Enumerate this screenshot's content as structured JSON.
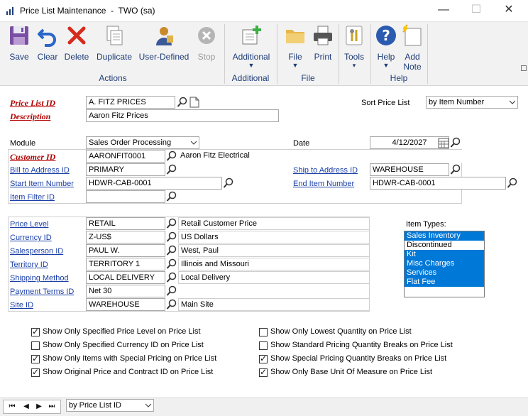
{
  "window": {
    "title": "Price List Maintenance  -  TWO (sa)",
    "minimize_glyph": "—",
    "maximize_glyph": "☐",
    "close_glyph": "✕"
  },
  "ribbon": {
    "buttons": {
      "save": "Save",
      "clear": "Clear",
      "delete": "Delete",
      "duplicate": "Duplicate",
      "user_defined": "User-Defined",
      "stop": "Stop",
      "additional": "Additional",
      "file": "File",
      "print": "Print",
      "tools": "Tools",
      "help": "Help",
      "add_note_1": "Add",
      "add_note_2": "Note"
    },
    "groups": {
      "actions": "Actions",
      "additional": "Additional",
      "file": "File",
      "help": "Help"
    }
  },
  "form": {
    "price_list_id_label": "Price List ID",
    "price_list_id_value": "A. FITZ PRICES",
    "description_label": "Description",
    "description_value": "Aaron Fitz Prices",
    "sort_price_list_label": "Sort Price List",
    "sort_price_list_value": "by Item Number",
    "module_label": "Module",
    "module_value": "Sales Order Processing",
    "date_label": "Date",
    "date_value": "4/12/2027",
    "customer_id_label": "Customer ID",
    "customer_id_value": "AARONFIT0001",
    "customer_name": "Aaron Fitz Electrical",
    "bill_to_label": "Bill to Address ID",
    "bill_to_value": "PRIMARY",
    "ship_to_label": "Ship to Address ID",
    "ship_to_value": "WAREHOUSE",
    "start_item_label": "Start Item Number",
    "start_item_value": "HDWR-CAB-0001",
    "end_item_label": "End Item Number",
    "end_item_value": "HDWR-CAB-0001",
    "item_filter_label": "Item Filter ID",
    "item_filter_value": "",
    "price_level_label": "Price Level",
    "price_level_value": "RETAIL",
    "price_level_desc": "Retail Customer Price",
    "currency_label": "Currency ID",
    "currency_value": "Z-US$",
    "currency_desc": "US Dollars",
    "salesperson_label": "Salesperson ID",
    "salesperson_value": "PAUL W.",
    "salesperson_desc": "West, Paul",
    "territory_label": "Territory ID",
    "territory_value": "TERRITORY 1",
    "territory_desc": "Illinois and Missouri",
    "shipping_label": "Shipping Method",
    "shipping_value": "LOCAL DELIVERY",
    "shipping_desc": "Local Delivery",
    "payment_terms_label": "Payment Terms ID",
    "payment_terms_value": "Net 30",
    "site_label": "Site ID",
    "site_value": "WAREHOUSE",
    "site_desc": "Main Site",
    "item_types_label": "Item Types:",
    "item_types": [
      {
        "label": "Sales Inventory",
        "selected": true
      },
      {
        "label": "Discontinued",
        "selected": false
      },
      {
        "label": "Kit",
        "selected": true
      },
      {
        "label": "Misc Charges",
        "selected": true
      },
      {
        "label": "Services",
        "selected": true
      },
      {
        "label": "Flat Fee",
        "selected": true
      }
    ]
  },
  "options": {
    "opt1": {
      "label": "Show Only Specified Price Level on Price List",
      "checked": true
    },
    "opt2": {
      "label": "Show Only Specified Currency ID on Price List",
      "checked": false
    },
    "opt3": {
      "label": "Show Only Items with Special Pricing on Price List",
      "checked": true
    },
    "opt4": {
      "label": "Show Original Price and Contract ID on Price List",
      "checked": true
    },
    "opt5": {
      "label": "Show Only Lowest Quantity on Price List",
      "checked": false
    },
    "opt6": {
      "label": "Show Standard Pricing Quantity Breaks on Price List",
      "checked": false
    },
    "opt7": {
      "label": "Show Special Pricing Quantity Breaks on Price List",
      "checked": true
    },
    "opt8": {
      "label": "Show Only Base Unit Of Measure on Price List",
      "checked": true
    }
  },
  "navbar": {
    "first": "⏮",
    "prev": "◀",
    "next": "▶",
    "last": "⏭",
    "sort_value": "by Price List ID"
  },
  "colors": {
    "required_label": "#b30000",
    "link_label": "#1a3fa8",
    "selection": "#0078d7",
    "ribbon_text": "#1e3c78"
  }
}
